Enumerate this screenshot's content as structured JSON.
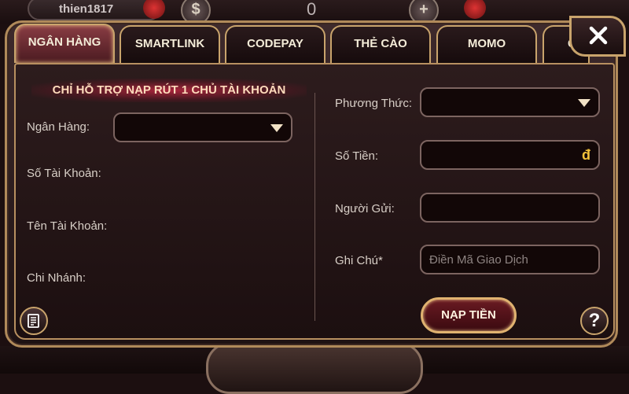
{
  "hud": {
    "username": "thien1817",
    "coin_symbol": "$",
    "balance": "0",
    "plus_symbol": "+"
  },
  "tabs": [
    {
      "label": "NGÂN HÀNG",
      "active": true
    },
    {
      "label": "SMARTLINK"
    },
    {
      "label": "CODEPAY"
    },
    {
      "label": "THẺ CÀO"
    },
    {
      "label": "MOMO"
    },
    {
      "label": "G"
    }
  ],
  "notice": "CHỈ HỖ TRỢ NẠP RÚT 1 CHỦ TÀI KHOẢN",
  "left_form": {
    "bank_label": "Ngân Hàng:",
    "bank_value": "",
    "account_number_label": "Số Tài Khoản:",
    "account_name_label": "Tên Tài Khoản:",
    "branch_label": "Chi Nhánh:"
  },
  "right_form": {
    "method_label": "Phương Thức:",
    "method_value": "",
    "amount_label": "Số Tiền:",
    "amount_value": "",
    "currency_symbol": "đ",
    "sender_label": "Người Gửi:",
    "sender_value": "",
    "note_label": "Ghi Chú*",
    "note_placeholder": "Điền Mã Giao Dịch"
  },
  "deposit_button": "NẠP TIỀN",
  "help_symbol": "?",
  "colors": {
    "gold_border": "#c9a46c",
    "accent_tab": "#8a3d44",
    "currency": "#f3c23a"
  }
}
